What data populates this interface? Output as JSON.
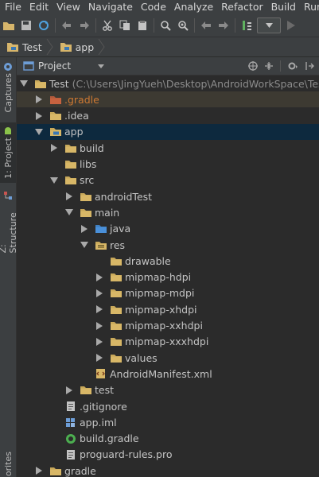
{
  "menu": [
    "File",
    "Edit",
    "View",
    "Navigate",
    "Code",
    "Analyze",
    "Refactor",
    "Build",
    "Run"
  ],
  "breadcrumbs": [
    "Test",
    "app"
  ],
  "panel": {
    "title": "Project"
  },
  "left_tabs": [
    "Captures",
    "1: Project",
    "Z: Structure",
    "orites"
  ],
  "tree": [
    {
      "label": "Test",
      "sub": "(C:\\Users\\JingYueh\\Desktop\\AndroidWorkSpace\\Test)",
      "depth": 0,
      "expanded": true,
      "icon": "project-folder-icon"
    },
    {
      "label": ".gradle",
      "depth": 1,
      "expanded": false,
      "icon": "folder-excluded-icon",
      "state": "dim",
      "color": "#cc7832"
    },
    {
      "label": ".idea",
      "depth": 1,
      "expanded": false,
      "icon": "folder-icon"
    },
    {
      "label": "app",
      "depth": 1,
      "expanded": true,
      "icon": "module-folder-icon",
      "state": "selected"
    },
    {
      "label": "build",
      "depth": 2,
      "expanded": false,
      "icon": "folder-icon"
    },
    {
      "label": "libs",
      "depth": 2,
      "icon": "folder-icon"
    },
    {
      "label": "src",
      "depth": 2,
      "expanded": true,
      "icon": "folder-icon"
    },
    {
      "label": "androidTest",
      "depth": 3,
      "expanded": false,
      "icon": "folder-icon"
    },
    {
      "label": "main",
      "depth": 3,
      "expanded": true,
      "icon": "folder-icon"
    },
    {
      "label": "java",
      "depth": 4,
      "expanded": false,
      "icon": "source-folder-icon"
    },
    {
      "label": "res",
      "depth": 4,
      "expanded": true,
      "icon": "resource-folder-icon"
    },
    {
      "label": "drawable",
      "depth": 5,
      "icon": "folder-icon"
    },
    {
      "label": "mipmap-hdpi",
      "depth": 5,
      "expanded": false,
      "icon": "folder-icon"
    },
    {
      "label": "mipmap-mdpi",
      "depth": 5,
      "expanded": false,
      "icon": "folder-icon"
    },
    {
      "label": "mipmap-xhdpi",
      "depth": 5,
      "expanded": false,
      "icon": "folder-icon"
    },
    {
      "label": "mipmap-xxhdpi",
      "depth": 5,
      "expanded": false,
      "icon": "folder-icon"
    },
    {
      "label": "mipmap-xxxhdpi",
      "depth": 5,
      "expanded": false,
      "icon": "folder-icon"
    },
    {
      "label": "values",
      "depth": 5,
      "expanded": false,
      "icon": "folder-icon"
    },
    {
      "label": "AndroidManifest.xml",
      "depth": 4,
      "icon": "xml-file-icon"
    },
    {
      "label": "test",
      "depth": 3,
      "expanded": false,
      "icon": "folder-icon"
    },
    {
      "label": ".gitignore",
      "depth": 2,
      "icon": "text-file-icon"
    },
    {
      "label": "app.iml",
      "depth": 2,
      "icon": "iml-file-icon"
    },
    {
      "label": "build.gradle",
      "depth": 2,
      "icon": "gradle-file-icon"
    },
    {
      "label": "proguard-rules.pro",
      "depth": 2,
      "icon": "text-file-icon"
    },
    {
      "label": "gradle",
      "depth": 1,
      "expanded": false,
      "icon": "folder-icon"
    }
  ]
}
